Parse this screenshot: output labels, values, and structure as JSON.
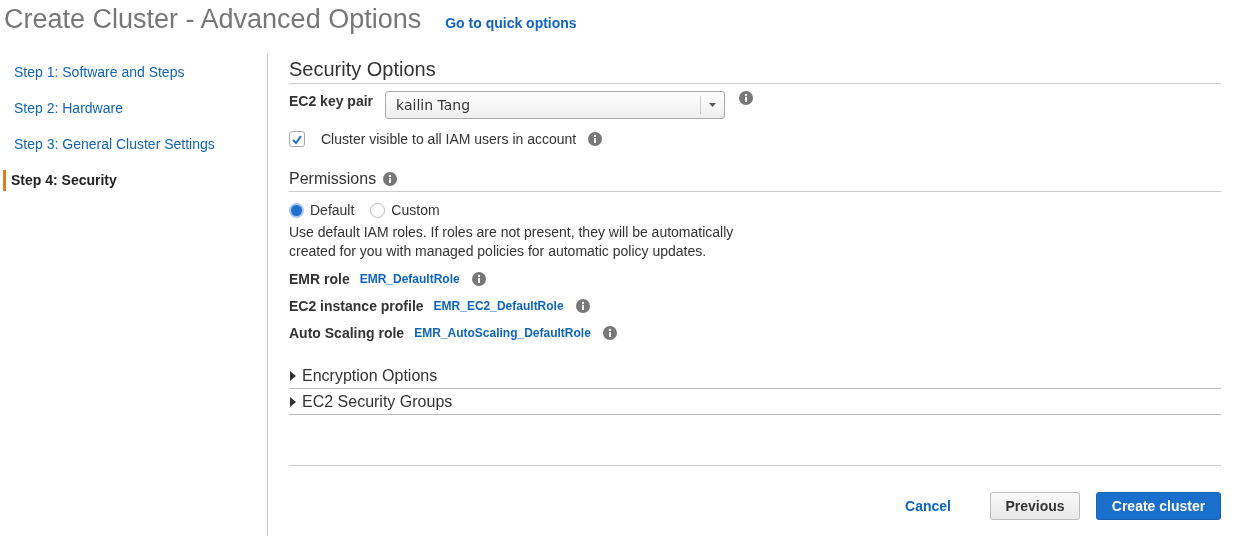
{
  "header": {
    "title": "Create Cluster - Advanced Options",
    "link": "Go to quick options"
  },
  "steps": [
    {
      "label": "Step 1: Software and Steps",
      "selected": false
    },
    {
      "label": "Step 2: Hardware",
      "selected": false
    },
    {
      "label": "Step 3: General Cluster Settings",
      "selected": false
    },
    {
      "label": "Step 4: Security",
      "selected": true
    }
  ],
  "security": {
    "heading": "Security Options",
    "key_pair_label": "EC2 key pair",
    "key_pair_value": "kailin Tang",
    "visible_checkbox": {
      "label": "Cluster visible to all IAM users in account",
      "checked": true
    }
  },
  "permissions": {
    "heading": "Permissions",
    "options": [
      {
        "label": "Default",
        "selected": true
      },
      {
        "label": "Custom",
        "selected": false
      }
    ],
    "description": "Use default IAM roles. If roles are not present, they will be automatically created for you with managed policies for automatic policy updates.",
    "roles": [
      {
        "label": "EMR role",
        "value": "EMR_DefaultRole"
      },
      {
        "label": "EC2 instance profile",
        "value": "EMR_EC2_DefaultRole"
      },
      {
        "label": "Auto Scaling role",
        "value": "EMR_AutoScaling_DefaultRole"
      }
    ]
  },
  "sections": [
    {
      "label": "Encryption Options",
      "expanded": false
    },
    {
      "label": "EC2 Security Groups",
      "expanded": false
    }
  ],
  "buttons": {
    "cancel": "Cancel",
    "previous": "Previous",
    "create": "Create cluster"
  }
}
